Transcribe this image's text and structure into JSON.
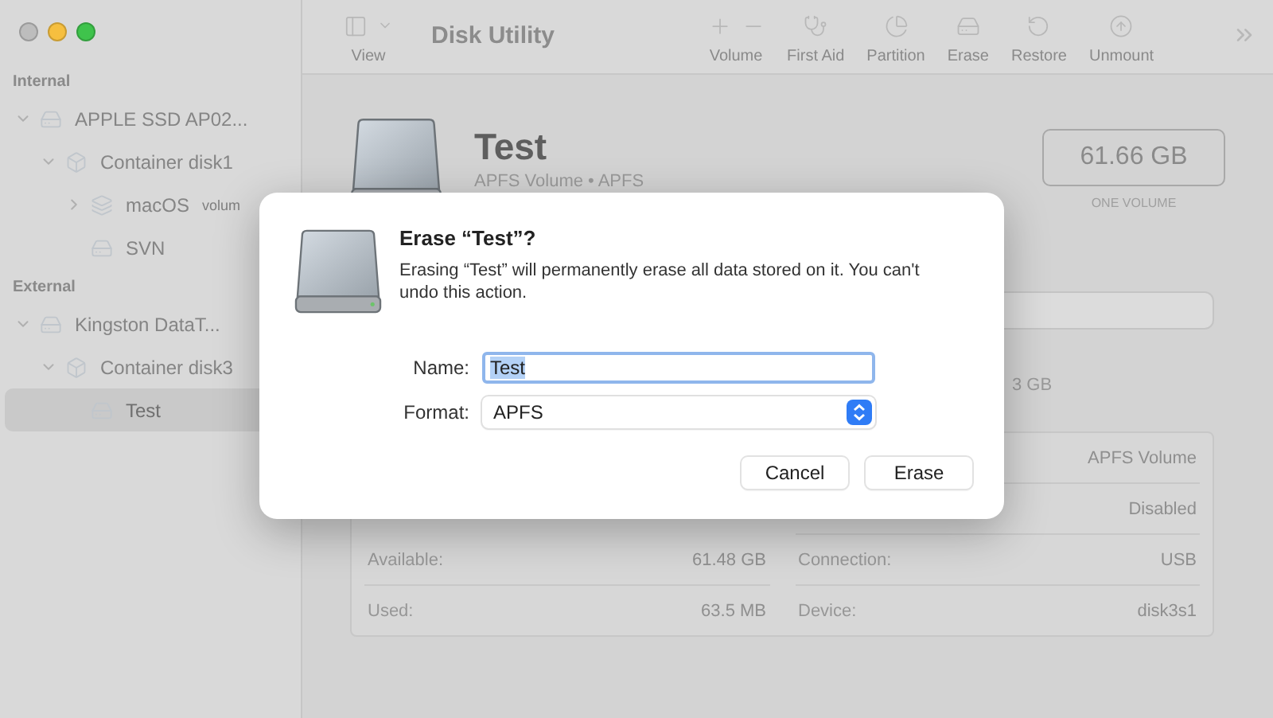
{
  "window": {
    "title": "Disk Utility"
  },
  "sidebar": {
    "sections": [
      {
        "heading": "Internal",
        "items": [
          {
            "kind": "disk",
            "label": "APPLE SSD AP02...",
            "expanded": true,
            "selected": false,
            "children": [
              {
                "kind": "container",
                "label": "Container disk1",
                "expanded": true,
                "selected": false,
                "children": [
                  {
                    "kind": "volume-group",
                    "label": "macOS",
                    "sublabel": "volum",
                    "expanded": false,
                    "selected": false
                  },
                  {
                    "kind": "volume",
                    "label": "SVN",
                    "selected": false
                  }
                ]
              }
            ]
          }
        ]
      },
      {
        "heading": "External",
        "items": [
          {
            "kind": "disk",
            "label": "Kingston DataT...",
            "expanded": true,
            "selected": false,
            "children": [
              {
                "kind": "container",
                "label": "Container disk3",
                "expanded": true,
                "selected": false,
                "children": [
                  {
                    "kind": "volume",
                    "label": "Test",
                    "selected": true
                  }
                ]
              }
            ]
          }
        ]
      }
    ]
  },
  "toolbar": {
    "view_label": "View",
    "actions": [
      {
        "kind": "volume",
        "label": "Volume"
      },
      {
        "kind": "first-aid",
        "label": "First Aid"
      },
      {
        "kind": "partition",
        "label": "Partition"
      },
      {
        "kind": "erase",
        "label": "Erase"
      },
      {
        "kind": "restore",
        "label": "Restore"
      },
      {
        "kind": "unmount",
        "label": "Unmount"
      }
    ]
  },
  "volume": {
    "name": "Test",
    "subtitle": "APFS Volume • APFS",
    "size": "61.66 GB",
    "size_caption": "ONE VOLUME",
    "usage_legend": "3 GB",
    "info_left": [
      {
        "label": "Available:",
        "value": "61.48 GB"
      },
      {
        "label": "Used:",
        "value": "63.5 MB"
      }
    ],
    "info_right": [
      {
        "value": "APFS Volume"
      },
      {
        "value": "Disabled"
      },
      {
        "label": "Connection:",
        "value": "USB"
      },
      {
        "label": "Device:",
        "value": "disk3s1"
      }
    ]
  },
  "dialog": {
    "title": "Erase “Test”?",
    "message": "Erasing “Test” will permanently erase all data stored on it. You can't undo this action.",
    "fields": [
      {
        "kind": "text",
        "label": "Name:",
        "value": "Test",
        "text_selected": true
      },
      {
        "kind": "popup",
        "label": "Format:",
        "value": "APFS"
      }
    ],
    "buttons": [
      {
        "label": "Cancel"
      },
      {
        "label": "Erase"
      }
    ]
  }
}
